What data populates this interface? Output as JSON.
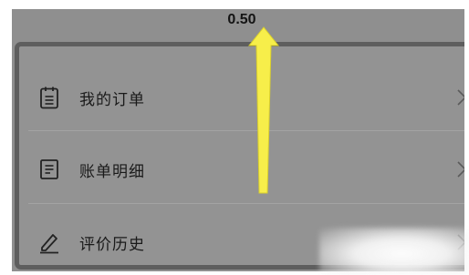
{
  "balance": {
    "value": "0.50"
  },
  "menu": {
    "items": [
      {
        "label": "我的订单",
        "icon": "clipboard-icon"
      },
      {
        "label": "账单明细",
        "icon": "document-icon"
      },
      {
        "label": "评价历史",
        "icon": "pencil-icon"
      }
    ]
  },
  "colors": {
    "overlay": "#8f8f8f",
    "card_border": "#5e5e5e",
    "arrow": "#f7ee4a"
  }
}
